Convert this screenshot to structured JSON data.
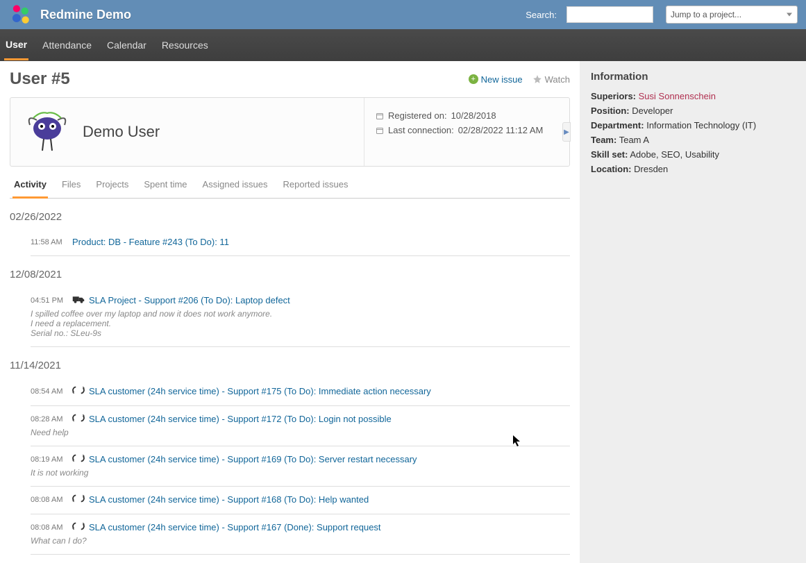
{
  "top": {
    "brand": "Redmine Demo",
    "search_label": "Search:",
    "project_select": "Jump to a project..."
  },
  "nav": {
    "items": [
      "User",
      "Attendance",
      "Calendar",
      "Resources"
    ],
    "active_index": 0
  },
  "page": {
    "title": "User #5",
    "actions": {
      "new_issue": "New issue",
      "watch": "Watch"
    }
  },
  "user_card": {
    "display_name": "Demo User",
    "registered_label": "Registered on:",
    "registered_date": "10/28/2018",
    "last_conn_label": "Last connection:",
    "last_conn_date": "02/28/2022 11:12 AM"
  },
  "subtabs": {
    "items": [
      "Activity",
      "Files",
      "Projects",
      "Spent time",
      "Assigned issues",
      "Reported issues"
    ],
    "active_index": 0
  },
  "activity": [
    {
      "date": "02/26/2022",
      "entries": [
        {
          "time": "11:58 AM",
          "icon": "none",
          "link": "Product: DB - Feature #243 (To Do): 11",
          "desc": ""
        }
      ]
    },
    {
      "date": "12/08/2021",
      "entries": [
        {
          "time": "04:51 PM",
          "icon": "truck",
          "link": "SLA Project - Support #206 (To Do): Laptop defect",
          "desc": "I spilled coffee over my laptop and now it does not work anymore.\nI need a replacement.\nSerial no.: SLeu-9s"
        }
      ]
    },
    {
      "date": "11/14/2021",
      "entries": [
        {
          "time": "08:54 AM",
          "icon": "cycle",
          "link": "SLA customer (24h service time) - Support #175 (To Do): Immediate action necessary",
          "desc": ""
        },
        {
          "time": "08:28 AM",
          "icon": "cycle",
          "link": "SLA customer (24h service time) - Support #172 (To Do): Login not possible",
          "desc": "Need help"
        },
        {
          "time": "08:19 AM",
          "icon": "cycle",
          "link": "SLA customer (24h service time) - Support #169 (To Do): Server restart necessary",
          "desc": "It is not working"
        },
        {
          "time": "08:08 AM",
          "icon": "cycle",
          "link": "SLA customer (24h service time) - Support #168 (To Do): Help wanted",
          "desc": ""
        },
        {
          "time": "08:08 AM",
          "icon": "cycle",
          "link": "SLA customer (24h service time) - Support #167 (Done): Support request",
          "desc": "What can I do?"
        }
      ]
    }
  ],
  "sidebar": {
    "title": "Information",
    "rows": {
      "superiors": {
        "label": "Superiors:",
        "value": "Susi Sonnenschein",
        "is_link": true
      },
      "position": {
        "label": "Position:",
        "value": "Developer"
      },
      "department": {
        "label": "Department:",
        "value": "Information Technology (IT)"
      },
      "team": {
        "label": "Team:",
        "value": "Team A"
      },
      "skillset": {
        "label": "Skill set:",
        "value": "Adobe, SEO, Usability"
      },
      "location": {
        "label": "Location:",
        "value": "Dresden"
      }
    }
  }
}
